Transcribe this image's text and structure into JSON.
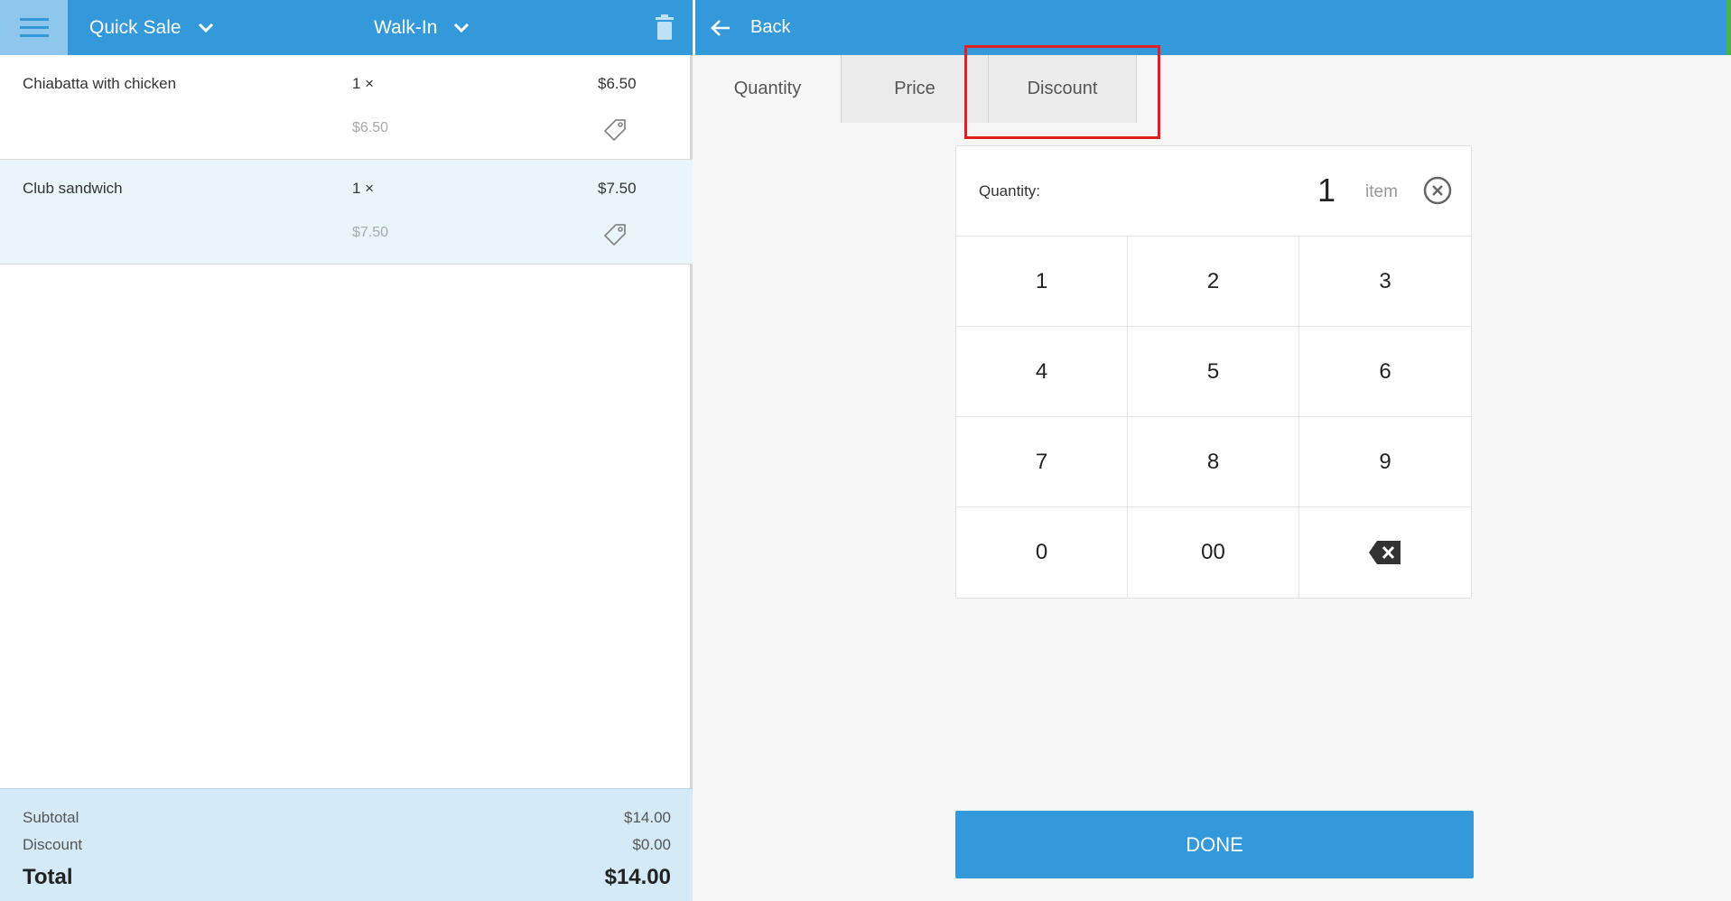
{
  "header": {
    "sale_type": "Quick Sale",
    "customer": "Walk-In"
  },
  "cart": {
    "items": [
      {
        "name": "Chiabatta with chicken",
        "qty": "1 ×",
        "price": "$6.50",
        "unit_price": "$6.50"
      },
      {
        "name": "Club sandwich",
        "qty": "1 ×",
        "price": "$7.50",
        "unit_price": "$7.50"
      }
    ],
    "totals": {
      "subtotal_label": "Subtotal",
      "subtotal": "$14.00",
      "discount_label": "Discount",
      "discount": "$0.00",
      "total_label": "Total",
      "total": "$14.00"
    }
  },
  "editor": {
    "back_label": "Back",
    "tabs": [
      "Quantity",
      "Price",
      "Discount"
    ],
    "active_tab": "Quantity",
    "display": {
      "label": "Quantity:",
      "value": "1",
      "unit": "item"
    },
    "keys": [
      "1",
      "2",
      "3",
      "4",
      "5",
      "6",
      "7",
      "8",
      "9",
      "0",
      "00"
    ],
    "done_label": "DONE"
  },
  "colors": {
    "brand": "#3399db",
    "selected_row": "#e9f4fb",
    "totals_bg": "#d4ebf7",
    "highlight": "#e02020"
  }
}
